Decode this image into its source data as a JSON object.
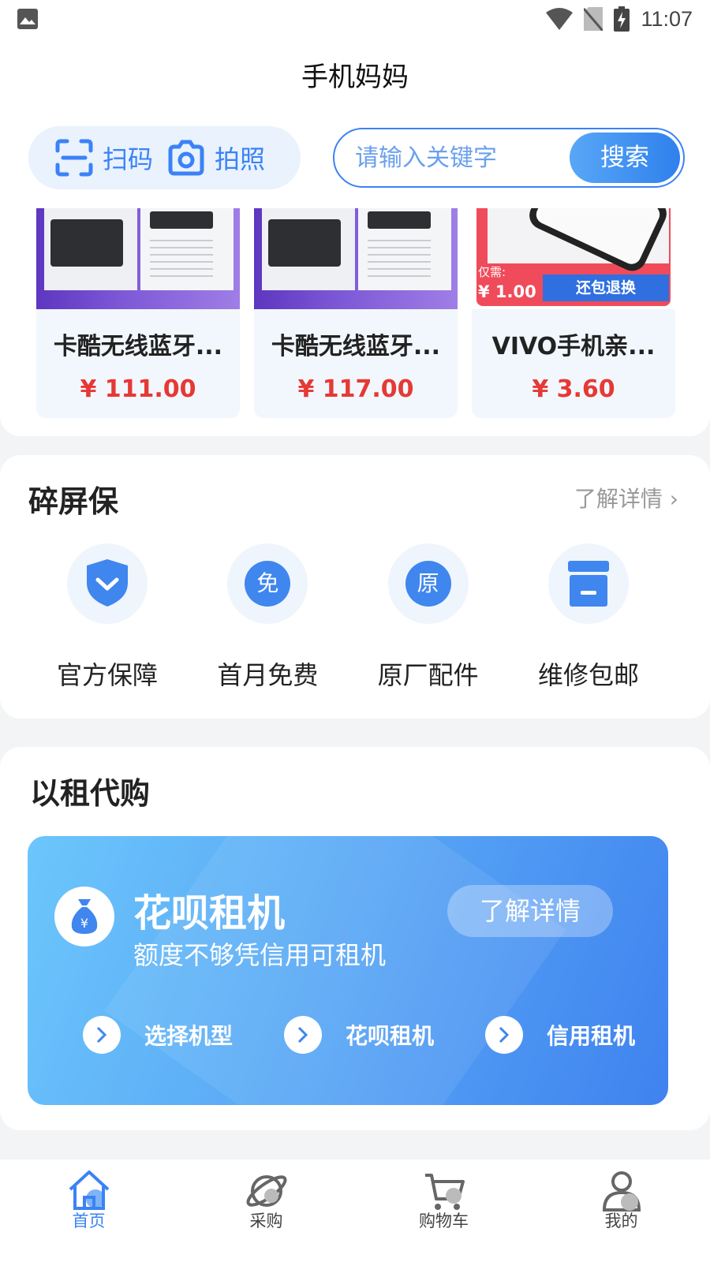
{
  "status_bar": {
    "time": "11:07"
  },
  "header": {
    "title": "手机妈妈"
  },
  "search": {
    "scan_label": "扫码",
    "photo_label": "拍照",
    "placeholder": "请输入关键字",
    "button": "搜索"
  },
  "products": [
    {
      "name": "卡酷无线蓝牙...",
      "price": "¥ 111.00"
    },
    {
      "name": "卡酷无线蓝牙...",
      "price": "¥ 117.00"
    },
    {
      "name": "VIVO手机亲...",
      "price": "¥ 3.60",
      "badge_need": "仅需:",
      "badge_price": "¥ 1.00",
      "badge_text": "还包退换"
    }
  ],
  "screen_protect": {
    "title": "碎屏保",
    "more": "了解详情 ›",
    "items": [
      {
        "label": "官方保障",
        "icon": "shield-check-icon",
        "glyph": ""
      },
      {
        "label": "首月免费",
        "icon": "free-badge-icon",
        "glyph": "免"
      },
      {
        "label": "原厂配件",
        "icon": "original-badge-icon",
        "glyph": "原"
      },
      {
        "label": "维修包邮",
        "icon": "box-icon",
        "glyph": ""
      }
    ]
  },
  "rent": {
    "title": "以租代购",
    "banner_title": "花呗租机",
    "banner_sub": "额度不够凭信用可租机",
    "banner_button": "了解详情",
    "steps": [
      "选择机型",
      "花呗租机",
      "信用租机"
    ]
  },
  "bottom_nav": [
    {
      "label": "首页",
      "icon": "home-icon",
      "active": true
    },
    {
      "label": "采购",
      "icon": "planet-icon",
      "active": false
    },
    {
      "label": "购物车",
      "icon": "cart-icon",
      "active": false
    },
    {
      "label": "我的",
      "icon": "user-icon",
      "active": false
    }
  ],
  "colors": {
    "accent": "#3b82f6",
    "price": "#e53935",
    "banner_start": "#6cc6fb",
    "banner_end": "#3f82ef"
  }
}
